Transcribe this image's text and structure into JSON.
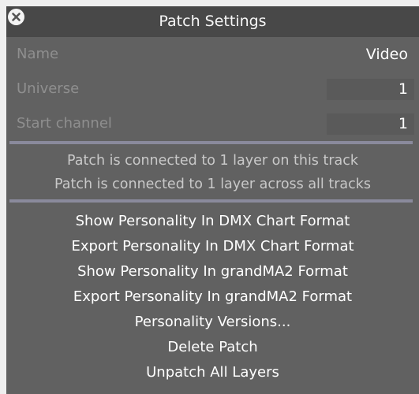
{
  "dialog": {
    "title": "Patch Settings",
    "close_icon": "close-icon"
  },
  "fields": [
    {
      "label": "Name",
      "value": "Video"
    },
    {
      "label": "Universe",
      "value": "1"
    },
    {
      "label": "Start channel",
      "value": "1"
    }
  ],
  "info": {
    "track_line": "Patch is connected to 1 layer on this track",
    "all_tracks_line": "Patch is connected to 1 layer across all tracks"
  },
  "actions": [
    "Show Personality In DMX Chart Format",
    "Export Personality In DMX Chart Format",
    "Show Personality In grandMA2 Format",
    "Export Personality In grandMA2 Format",
    "Personality Versions...",
    "Delete Patch",
    "Unpatch All Layers"
  ],
  "colors": {
    "panel": "#616161",
    "titlebar": "#484848",
    "divider": "#8a8a9c",
    "label": "#8f8f8f"
  }
}
